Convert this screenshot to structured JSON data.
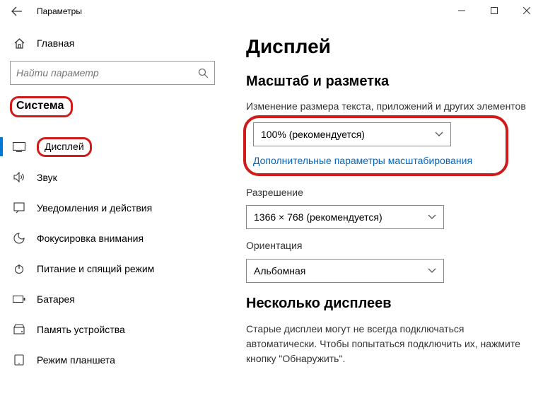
{
  "window": {
    "title": "Параметры"
  },
  "sidebar": {
    "home": "Главная",
    "search_placeholder": "Найти параметр",
    "category": "Система",
    "items": [
      {
        "label": "Дисплей"
      },
      {
        "label": "Звук"
      },
      {
        "label": "Уведомления и действия"
      },
      {
        "label": "Фокусировка внимания"
      },
      {
        "label": "Питание и спящий режим"
      },
      {
        "label": "Батарея"
      },
      {
        "label": "Память устройства"
      },
      {
        "label": "Режим планшета"
      }
    ]
  },
  "content": {
    "title": "Дисплей",
    "scale_heading": "Масштаб и разметка",
    "scale_label": "Изменение размера текста, приложений и других элементов",
    "scale_value": "100% (рекомендуется)",
    "advanced_scaling": "Дополнительные параметры масштабирования",
    "resolution_label": "Разрешение",
    "resolution_value": "1366 × 768 (рекомендуется)",
    "orientation_label": "Ориентация",
    "orientation_value": "Альбомная",
    "multi_heading": "Несколько дисплеев",
    "multi_text": "Старые дисплеи могут не всегда подключаться автоматически. Чтобы попытаться подключить их, нажмите кнопку \"Обнаружить\"."
  }
}
